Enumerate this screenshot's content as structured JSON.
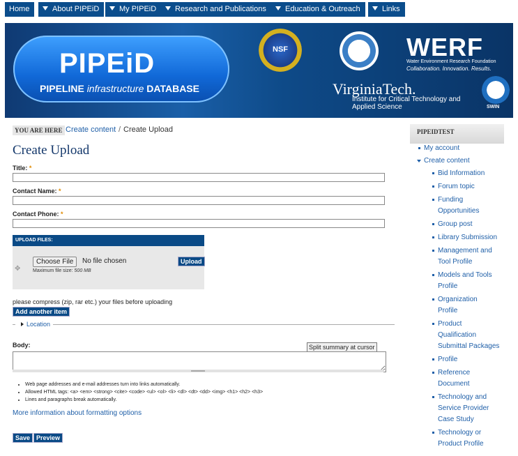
{
  "nav": {
    "home": "Home",
    "about": "About PIPEiD",
    "my": "My PIPEiD",
    "research": "Research and Publications",
    "education": "Education & Outreach",
    "links": "Links"
  },
  "banner": {
    "logo_main": "PIPEiD",
    "logo_sub_a": "PIPELINE ",
    "logo_sub_b": "infrastructure",
    "logo_sub_c": " DATABASE",
    "nsf": "NSF",
    "werf": "WERF",
    "werf_sub": "Water Environment Research Foundation",
    "werf_tag": "Collaboration. Innovation. Results.",
    "vt": "VirginiaTech.",
    "vt_sub": "Institute for Critical Technology and Applied Science",
    "swin": "SWIN"
  },
  "breadcrumb": {
    "you_are_here": "YOU ARE HERE",
    "crumb1": "Create content",
    "sep": "/",
    "crumb2": "Create Upload"
  },
  "form": {
    "title": "Create Upload",
    "title_label": "Title:",
    "contact_name_label": "Contact Name:",
    "contact_phone_label": "Contact Phone:",
    "required_mark": "*",
    "upload_header": "UPLOAD FILES:",
    "choose_file": "Choose File",
    "no_file": "No file chosen",
    "max_size_label": "Maximum file size:",
    "max_size_value": "500 MB",
    "upload_button": "Upload",
    "compress_note": "please compress (zip, rar etc.) your files before uploading",
    "add_another": "Add another item",
    "location": "Location",
    "body_label": "Body:",
    "split_summary": "Split summary at cursor",
    "tips": [
      "Web page addresses and e-mail addresses turn into links automatically.",
      "Allowed HTML tags: <a> <em> <strong> <cite> <code> <ul> <ol> <li> <dl> <dt> <dd> <img> <h1> <h2> <h3>",
      "Lines and paragraphs break automatically."
    ],
    "more_info": "More information about formatting options",
    "save": "Save",
    "preview": "Preview"
  },
  "sidebar": {
    "title": "PIPEIDTEST",
    "my_account": "My account",
    "create_content": "Create content",
    "items": [
      "Bid Information",
      "Forum topic",
      "Funding\nOpportunities",
      "Group post",
      "Library Submission",
      "Management and\nTool Profile",
      "Models and Tools\nProfile",
      "Organization\nProfile",
      "Product\nQualification\nSubmittal Packages",
      "Profile",
      "Reference\nDocument",
      "Technology and\nService Provider\nCase Study",
      "Technology or\nProduct Profile"
    ]
  },
  "colors": {
    "nav_bg": "#0b4d8c",
    "link": "#1f5fa8",
    "title": "#14386b",
    "required": "#e08a00"
  }
}
